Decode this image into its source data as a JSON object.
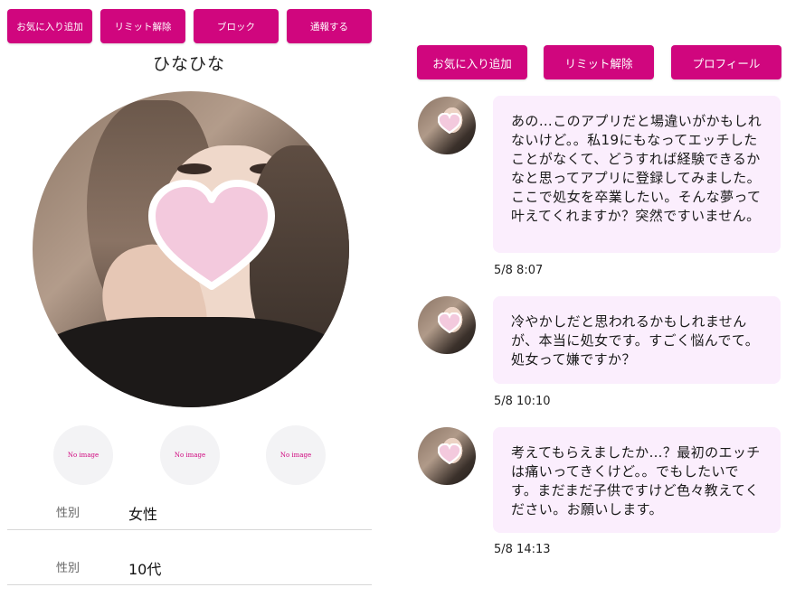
{
  "left_buttons": {
    "favorite": "お気に入り追加",
    "unlimit": "リミット解除",
    "block": "ブロック",
    "report": "通報する"
  },
  "right_buttons": {
    "favorite": "お気に入り追加",
    "unlimit": "リミット解除",
    "profile": "プロフィール"
  },
  "profile": {
    "name": "ひなひな",
    "thumbnails": [
      "No image",
      "No image",
      "No image"
    ],
    "fields": [
      {
        "label": "性別",
        "value": "女性"
      },
      {
        "label": "性別",
        "value": "10代"
      }
    ]
  },
  "messages": [
    {
      "text": "あの…このアプリだと場違いがかもしれないけど。。私19にもなってエッチしたことがなくて、どうすれば経験できるかなと思ってアプリに登録してみました。ここで処女を卒業したい。そんな夢って叶えてくれますか？突然ですいません。",
      "time": "5/8 8:07"
    },
    {
      "text": "冷やかしだと思われるかもしれませんが、本当に処女です。すごく悩んでて。処女って嫌ですか？",
      "time": "5/8 10:10"
    },
    {
      "text": "考えてもらえましたか…？最初のエッチは痛いってきくけど。。でもしたいです。まだまだ子供ですけど色々教えてください。お願いします。",
      "time": "5/8 14:13"
    }
  ],
  "colors": {
    "accent": "#d0067e",
    "bubble": "#fbeefd",
    "heart": "#f3c9dd"
  }
}
